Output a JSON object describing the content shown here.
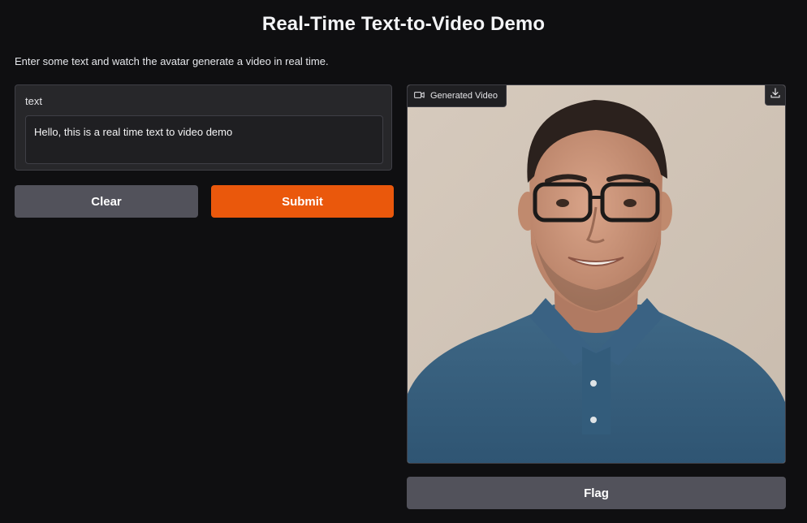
{
  "header": {
    "title": "Real-Time Text-to-Video Demo",
    "description": "Enter some text and watch the avatar generate a video in real time."
  },
  "input": {
    "label": "text",
    "value": "Hello, this is a real time text to video demo"
  },
  "buttons": {
    "clear": "Clear",
    "submit": "Submit",
    "flag": "Flag"
  },
  "video": {
    "label": "Generated Video",
    "icon": "video-camera-icon",
    "download_icon": "download-icon"
  },
  "colors": {
    "background": "#0f0f11",
    "primary": "#ea580c",
    "secondary": "#52525b"
  }
}
